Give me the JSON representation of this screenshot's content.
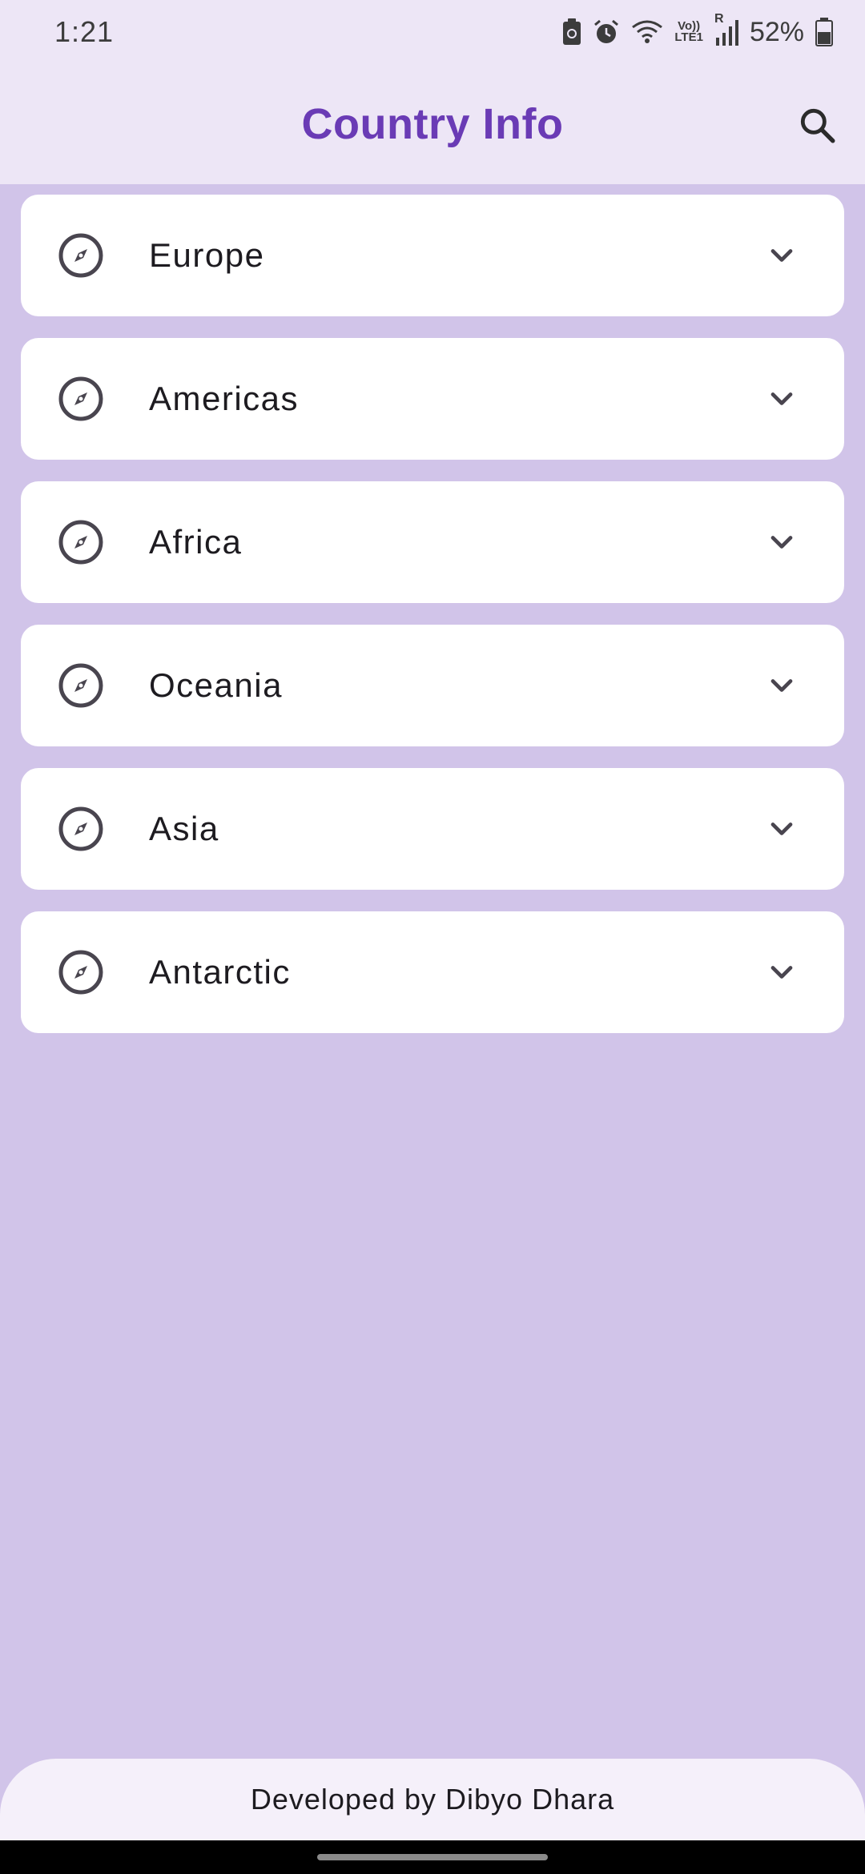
{
  "status_bar": {
    "time": "1:21",
    "volte_label": "Vo))",
    "lte_label": "LTE1",
    "roaming_label": "R",
    "battery": "52%",
    "icons": [
      "battery-saver-icon",
      "alarm-icon",
      "wifi-icon",
      "volte-icon",
      "signal-icon",
      "battery-icon"
    ]
  },
  "app_bar": {
    "title": "Country Info",
    "title_color": "#6a3bb5",
    "search_icon": "search-icon"
  },
  "regions": [
    {
      "label": "Europe",
      "icon": "compass-icon"
    },
    {
      "label": "Americas",
      "icon": "compass-icon"
    },
    {
      "label": "Africa",
      "icon": "compass-icon"
    },
    {
      "label": "Oceania",
      "icon": "compass-icon"
    },
    {
      "label": "Asia",
      "icon": "compass-icon"
    },
    {
      "label": "Antarctic",
      "icon": "compass-icon"
    }
  ],
  "footer": {
    "text": "Developed by Dibyo Dhara"
  },
  "colors": {
    "background": "#d1c4e9",
    "app_bar": "#ede6f6",
    "card": "#ffffff",
    "accent": "#6a3bb5"
  }
}
